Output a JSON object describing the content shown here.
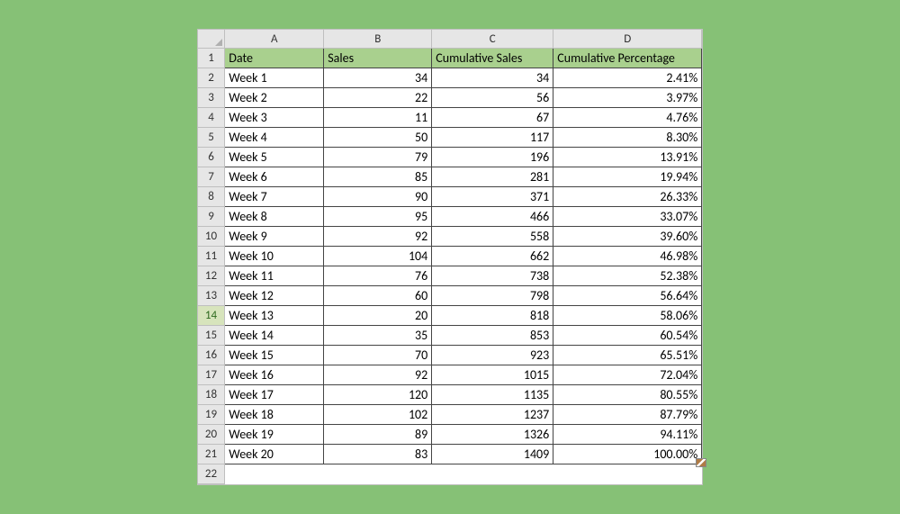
{
  "columns": [
    {
      "letter": "A",
      "header": "Date",
      "cls": "colA"
    },
    {
      "letter": "B",
      "header": "Sales",
      "cls": "colB"
    },
    {
      "letter": "C",
      "header": "Cumulative Sales",
      "cls": "colC"
    },
    {
      "letter": "D",
      "header": "Cumulative Percentage",
      "cls": "colD"
    }
  ],
  "selected_row_header": 14,
  "rows": [
    {
      "n": 1,
      "date": "Date",
      "sales": "Sales",
      "cum": "Cumulative Sales",
      "pct": "Cumulative Percentage",
      "is_header": true
    },
    {
      "n": 2,
      "date": "Week 1",
      "sales": "34",
      "cum": "34",
      "pct": "2.41%"
    },
    {
      "n": 3,
      "date": "Week 2",
      "sales": "22",
      "cum": "56",
      "pct": "3.97%"
    },
    {
      "n": 4,
      "date": "Week 3",
      "sales": "11",
      "cum": "67",
      "pct": "4.76%"
    },
    {
      "n": 5,
      "date": "Week 4",
      "sales": "50",
      "cum": "117",
      "pct": "8.30%"
    },
    {
      "n": 6,
      "date": "Week 5",
      "sales": "79",
      "cum": "196",
      "pct": "13.91%"
    },
    {
      "n": 7,
      "date": "Week 6",
      "sales": "85",
      "cum": "281",
      "pct": "19.94%"
    },
    {
      "n": 8,
      "date": "Week 7",
      "sales": "90",
      "cum": "371",
      "pct": "26.33%"
    },
    {
      "n": 9,
      "date": "Week 8",
      "sales": "95",
      "cum": "466",
      "pct": "33.07%"
    },
    {
      "n": 10,
      "date": "Week 9",
      "sales": "92",
      "cum": "558",
      "pct": "39.60%"
    },
    {
      "n": 11,
      "date": "Week 10",
      "sales": "104",
      "cum": "662",
      "pct": "46.98%"
    },
    {
      "n": 12,
      "date": "Week 11",
      "sales": "76",
      "cum": "738",
      "pct": "52.38%"
    },
    {
      "n": 13,
      "date": "Week 12",
      "sales": "60",
      "cum": "798",
      "pct": "56.64%"
    },
    {
      "n": 14,
      "date": "Week 13",
      "sales": "20",
      "cum": "818",
      "pct": "58.06%"
    },
    {
      "n": 15,
      "date": "Week 14",
      "sales": "35",
      "cum": "853",
      "pct": "60.54%"
    },
    {
      "n": 16,
      "date": "Week 15",
      "sales": "70",
      "cum": "923",
      "pct": "65.51%"
    },
    {
      "n": 17,
      "date": "Week 16",
      "sales": "92",
      "cum": "1015",
      "pct": "72.04%"
    },
    {
      "n": 18,
      "date": "Week 17",
      "sales": "120",
      "cum": "1135",
      "pct": "80.55%"
    },
    {
      "n": 19,
      "date": "Week 18",
      "sales": "102",
      "cum": "1237",
      "pct": "87.79%"
    },
    {
      "n": 20,
      "date": "Week 19",
      "sales": "89",
      "cum": "1326",
      "pct": "94.11%"
    },
    {
      "n": 21,
      "date": "Week 20",
      "sales": "83",
      "cum": "1409",
      "pct": "100.00%"
    },
    {
      "n": 22,
      "date": "",
      "sales": "",
      "cum": "",
      "pct": "",
      "empty": true
    }
  ]
}
